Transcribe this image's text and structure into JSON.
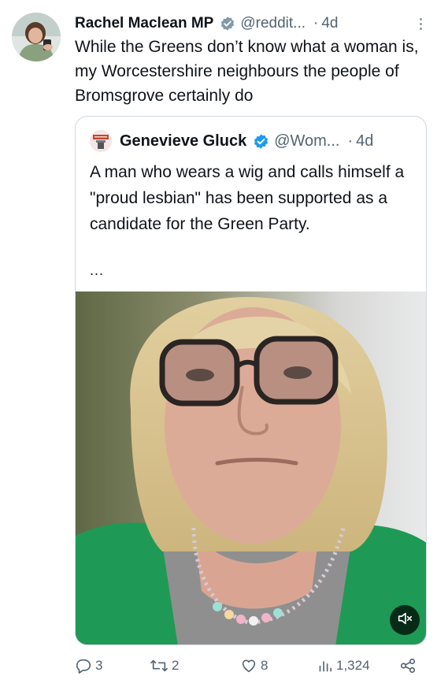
{
  "author": {
    "display_name": "Rachel Maclean MP",
    "handle": "@reddit...",
    "separator": "·",
    "age": "4d",
    "verified_color": "#829aab"
  },
  "tweet": {
    "text": "While the Greens don’t know what a woman is, my Worcestershire neighbours the people of Bromsgrove certainly do"
  },
  "quoted": {
    "display_name": "Genevieve Gluck",
    "handle": "@Wom...",
    "separator": "·",
    "age": "4d",
    "verified_color": "#1d9bf0",
    "text": "A man who wears a wig and calls himself a \"proud lesbian\" has been supported as a candidate for the Green Party.",
    "ellipsis": "...",
    "media": {
      "type": "video",
      "muted": true,
      "mute_icon": "speaker-muted-icon"
    }
  },
  "actions": {
    "replies": "3",
    "retweets": "2",
    "likes": "8",
    "views": "1,324"
  },
  "icons": [
    "comment-icon",
    "retweet-icon",
    "heart-icon",
    "views-icon",
    "share-icon",
    "more-icon",
    "verified-icon"
  ]
}
